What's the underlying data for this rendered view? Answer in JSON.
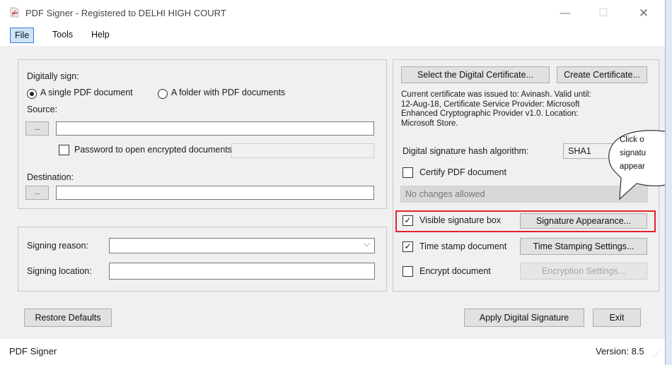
{
  "window": {
    "title": "PDF Signer - Registered to DELHI HIGH COURT",
    "minimize_glyph": "—",
    "maximize_glyph": "☐",
    "close_glyph": "✕"
  },
  "menu": {
    "file": "File",
    "tools": "Tools",
    "help": "Help"
  },
  "left_panel": {
    "digitally_sign_label": "Digitally sign:",
    "option_single": "A single PDF document",
    "option_folder": "A folder with PDF documents",
    "selected_option": "single",
    "source_label": "Source:",
    "browse_label": "...",
    "source_value": "",
    "password_label": "Password to open encrypted documents:",
    "password_checked": false,
    "password_value": "",
    "destination_label": "Destination:",
    "destination_value": ""
  },
  "signing": {
    "reason_label": "Signing reason:",
    "reason_value": "",
    "location_label": "Signing location:",
    "location_value": ""
  },
  "right_panel": {
    "select_cert_button": "Select the Digital Certificate...",
    "create_cert_button": "Create Certificate...",
    "cert_info_lines": [
      "Current certificate was issued to: Avinash. Valid until:",
      "12-Aug-18, Certificate Service Provider: Microsoft",
      "Enhanced Cryptographic Provider v1.0. Location:",
      "Microsoft Store."
    ],
    "hash_label": "Digital signature hash algorithm:",
    "hash_value": "SHA1",
    "certify_label": "Certify PDF document",
    "certify_checked": false,
    "changes_value": "No changes allowed",
    "visible_sig_label": "Visible signature box",
    "visible_sig_checked": true,
    "sig_appearance_button": "Signature Appearance...",
    "timestamp_label": "Time stamp document",
    "timestamp_checked": true,
    "timestamp_button": "Time Stamping Settings...",
    "encrypt_label": "Encrypt document",
    "encrypt_checked": false,
    "encrypt_button": "Encryption Settings...",
    "highlight_color": "#e0242c"
  },
  "callout": {
    "lines": [
      "Click o",
      "signatu",
      "appear"
    ]
  },
  "footer": {
    "restore_button": "Restore Defaults",
    "apply_button": "Apply Digital Signature",
    "exit_button": "Exit"
  },
  "status": {
    "left": "PDF Signer",
    "version": "Version: 8.5"
  },
  "icons": {
    "checked_glyph": "✓",
    "dropdown_glyph": "⌵"
  }
}
